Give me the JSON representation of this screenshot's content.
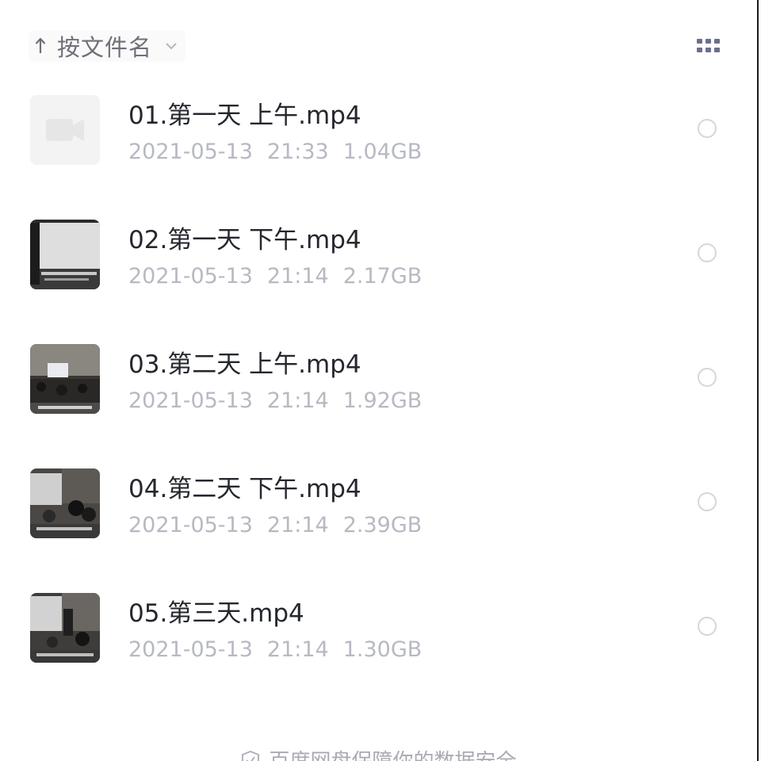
{
  "toolbar": {
    "sort_label": "按文件名",
    "sort_direction_icon": "arrow-up-icon",
    "sort_menu_icon": "chevron-down-icon",
    "view_toggle_icon": "grid-view-icon"
  },
  "files": [
    {
      "name": "01.第一天 上午.mp4",
      "date": "2021-05-13",
      "time": "21:33",
      "size": "1.04GB",
      "thumbnail": "video-placeholder-icon"
    },
    {
      "name": "02.第一天 下午.mp4",
      "date": "2021-05-13",
      "time": "21:14",
      "size": "2.17GB",
      "thumbnail": "video-thumbnail"
    },
    {
      "name": "03.第二天 上午.mp4",
      "date": "2021-05-13",
      "time": "21:14",
      "size": "1.92GB",
      "thumbnail": "video-thumbnail"
    },
    {
      "name": "04.第二天 下午.mp4",
      "date": "2021-05-13",
      "time": "21:14",
      "size": "2.39GB",
      "thumbnail": "video-thumbnail"
    },
    {
      "name": "05.第三天.mp4",
      "date": "2021-05-13",
      "time": "21:14",
      "size": "1.30GB",
      "thumbnail": "video-thumbnail"
    }
  ],
  "footer": {
    "text": "百度网盘保障你的数据安全",
    "icon": "shield-icon"
  },
  "colors": {
    "text_primary": "#25272e",
    "text_secondary": "#b7b9c2",
    "sort_text": "#6e7079",
    "grid_icon": "#6a6f8c"
  }
}
